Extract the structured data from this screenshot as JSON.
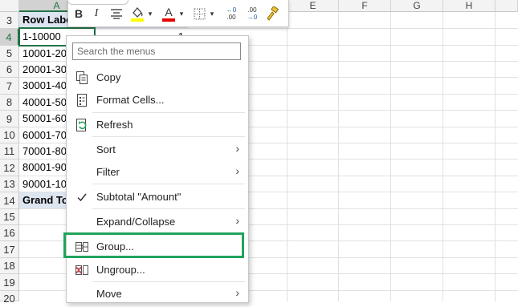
{
  "columns": [
    "A",
    "E",
    "F",
    "G",
    "H"
  ],
  "rows": [
    "3",
    "4",
    "5",
    "6",
    "7",
    "8",
    "9",
    "10",
    "11",
    "12",
    "13",
    "14",
    "15",
    "16",
    "17",
    "18",
    "19",
    "20"
  ],
  "cells": {
    "a3": "Row Labe",
    "a4": "1-10000",
    "b4": "1",
    "a5": "10001-20",
    "a6": "20001-30",
    "a7": "30001-40",
    "a8": "40001-50",
    "a9": "50001-60",
    "a10": "60001-70",
    "a11": "70001-80",
    "a12": "80001-90",
    "a13": "90001-10",
    "a14": "Grand To"
  },
  "minibar": {
    "bold": "B",
    "italic": "I",
    "font_color_letter": "A",
    "dec_inc_top": "←0",
    "dec_inc_bot": ".00",
    "dec_dec_top": ".00",
    "dec_dec_bot": "→0"
  },
  "menu": {
    "search_placeholder": "Search the menus",
    "items": [
      {
        "label": "Copy",
        "icon": "copy-icon"
      },
      {
        "label": "Format Cells...",
        "icon": "format-cells-icon"
      },
      {
        "label": "Refresh",
        "icon": "refresh-icon"
      },
      {
        "label": "Sort",
        "icon": "none",
        "submenu": true
      },
      {
        "label": "Filter",
        "icon": "none",
        "submenu": true
      },
      {
        "label": "Subtotal \"Amount\"",
        "icon": "checkmark-icon"
      },
      {
        "label": "Expand/Collapse",
        "icon": "none",
        "submenu": true
      },
      {
        "label": "Group...",
        "icon": "group-icon"
      },
      {
        "label": "Ungroup...",
        "icon": "ungroup-icon"
      },
      {
        "label": "Move",
        "icon": "none",
        "submenu": true
      }
    ]
  },
  "colors": {
    "accent_green": "#217346",
    "highlight_green": "#21a35a",
    "pivot_header_fill": "#dde5f1"
  }
}
